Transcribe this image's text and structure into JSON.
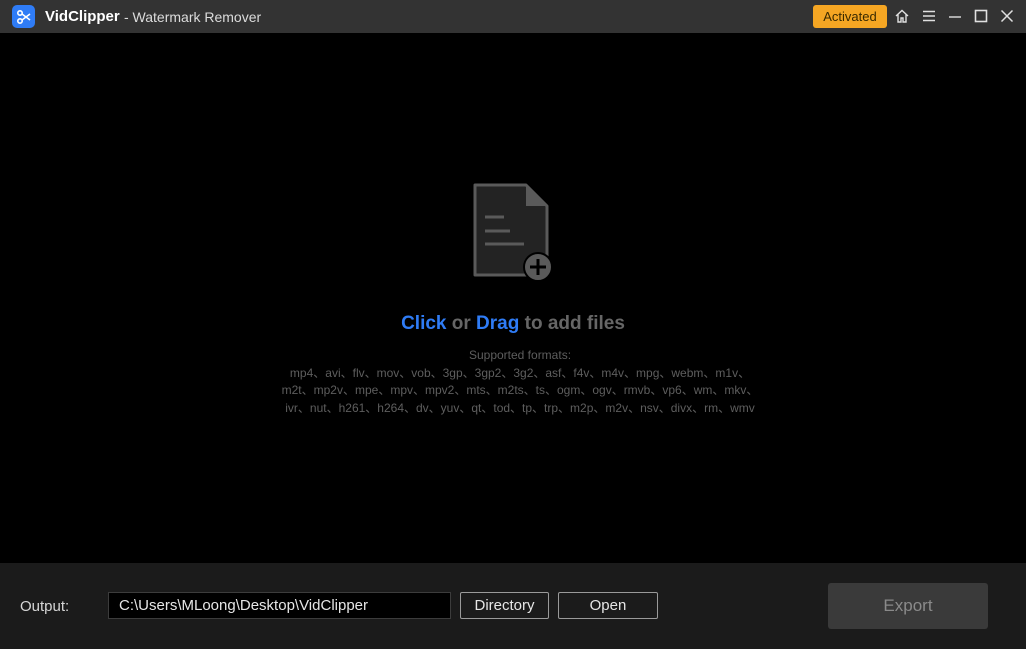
{
  "window": {
    "app_name": "VidClipper",
    "subtitle": "- Watermark Remover",
    "badge": "Activated"
  },
  "drop": {
    "click": "Click",
    "or": "or",
    "drag": "Drag",
    "tail": "to add files",
    "formats_title": "Supported formats:",
    "formats_line1": "mp4、avi、flv、mov、vob、3gp、3gp2、3g2、asf、f4v、m4v、mpg、webm、m1v、",
    "formats_line2": "m2t、mp2v、mpe、mpv、mpv2、mts、m2ts、ts、ogm、ogv、rmvb、vp6、wm、mkv、",
    "formats_line3": "ivr、nut、h261、h264、dv、yuv、qt、tod、tp、trp、m2p、m2v、nsv、divx、rm、wmv"
  },
  "bottom": {
    "output_label": "Output:",
    "output_path": "C:\\Users\\MLoong\\Desktop\\VidClipper",
    "directory": "Directory",
    "open": "Open",
    "export": "Export"
  },
  "colors": {
    "accent": "#2f7cf6",
    "badge": "#f5a623",
    "titlebar": "#333333"
  },
  "icons": [
    "app-logo-icon",
    "home-icon",
    "menu-icon",
    "minimize-icon",
    "maximize-icon",
    "close-icon",
    "add-file-icon"
  ]
}
